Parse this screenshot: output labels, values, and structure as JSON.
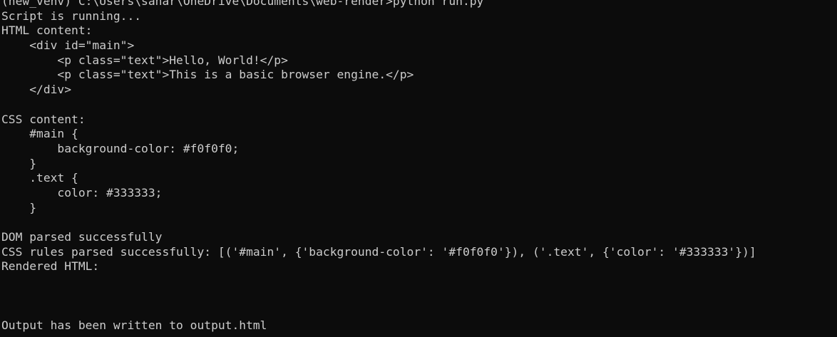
{
  "terminal": {
    "background": "#0c0c0c",
    "foreground": "#cccccc",
    "lines": [
      "(new_venv) C:\\Users\\sahar\\OneDrive\\Documents\\web-render>python run.py",
      "Script is running...",
      "HTML content:",
      "    <div id=\"main\">",
      "        <p class=\"text\">Hello, World!</p>",
      "        <p class=\"text\">This is a basic browser engine.</p>",
      "    </div>",
      "",
      "CSS content:",
      "    #main {",
      "        background-color: #f0f0f0;",
      "    }",
      "    .text {",
      "        color: #333333;",
      "    }",
      "",
      "DOM parsed successfully",
      "CSS rules parsed successfully: [('#main', {'background-color': '#f0f0f0'}), ('.text', {'color': '#333333'})]",
      "Rendered HTML:",
      "",
      "",
      "",
      "Output has been written to output.html"
    ]
  }
}
